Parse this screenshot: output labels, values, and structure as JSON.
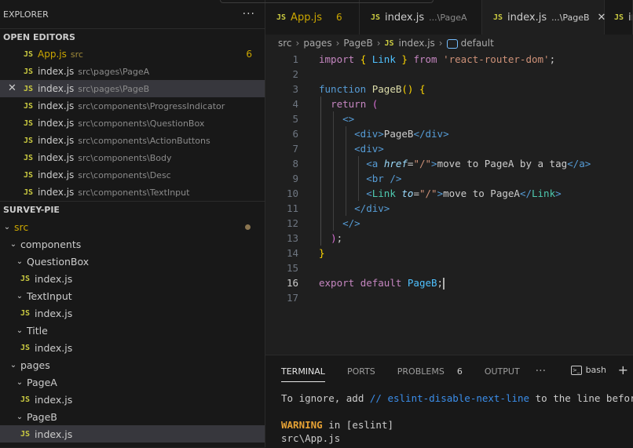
{
  "sidebar": {
    "title": "EXPLORER",
    "more": "···",
    "open_editors": {
      "title": "OPEN EDITORS",
      "items": [
        {
          "icon": "JS",
          "name": "App.js",
          "path": "src",
          "badge": "6"
        },
        {
          "icon": "JS",
          "name": "index.js",
          "path": "src\\pages\\PageA"
        },
        {
          "icon": "JS",
          "name": "index.js",
          "path": "src\\pages\\PageB"
        },
        {
          "icon": "JS",
          "name": "index.js",
          "path": "src\\components\\ProgressIndicator"
        },
        {
          "icon": "JS",
          "name": "index.js",
          "path": "src\\components\\QuestionBox"
        },
        {
          "icon": "JS",
          "name": "index.js",
          "path": "src\\components\\ActionButtons"
        },
        {
          "icon": "JS",
          "name": "index.js",
          "path": "src\\components\\Body"
        },
        {
          "icon": "JS",
          "name": "index.js",
          "path": "src\\components\\Desc"
        },
        {
          "icon": "JS",
          "name": "index.js",
          "path": "src\\components\\TextInput"
        }
      ]
    },
    "project": {
      "title": "SURVEY-PIE",
      "tree": [
        {
          "label": "src",
          "chevron": "⌄"
        },
        {
          "label": "components",
          "chevron": "⌄"
        },
        {
          "label": "QuestionBox",
          "chevron": "⌄"
        },
        {
          "label": "index.js",
          "icon": "JS"
        },
        {
          "label": "TextInput",
          "chevron": "⌄"
        },
        {
          "label": "index.js",
          "icon": "JS"
        },
        {
          "label": "Title",
          "chevron": "⌄"
        },
        {
          "label": "index.js",
          "icon": "JS"
        },
        {
          "label": "pages",
          "chevron": "⌄"
        },
        {
          "label": "PageA",
          "chevron": "⌄"
        },
        {
          "label": "index.js",
          "icon": "JS"
        },
        {
          "label": "PageB",
          "chevron": "⌄"
        },
        {
          "label": "index.js",
          "icon": "JS"
        }
      ]
    }
  },
  "tabs": [
    {
      "icon": "JS",
      "name": "App.js",
      "path": "",
      "badge": "6"
    },
    {
      "icon": "JS",
      "name": "index.js",
      "path": "...\\PageA"
    },
    {
      "icon": "JS",
      "name": "index.js",
      "path": "...\\PageB",
      "close": "✕"
    },
    {
      "icon": "JS",
      "name": "index"
    }
  ],
  "breadcrumb": {
    "parts": [
      "src",
      "pages",
      "PageB"
    ],
    "file_icon": "JS",
    "file": "index.js",
    "symbol": "default",
    "sep": "›"
  },
  "editor": {
    "line_numbers": [
      "1",
      "2",
      "3",
      "4",
      "5",
      "6",
      "7",
      "8",
      "9",
      "10",
      "11",
      "12",
      "13",
      "14",
      "15",
      "16",
      "17"
    ],
    "current_line": "16"
  },
  "panel": {
    "tabs": [
      "TERMINAL",
      "PORTS",
      "PROBLEMS",
      "OUTPUT"
    ],
    "problems_badge": "6",
    "more": "···",
    "shell": "bash",
    "add": "+",
    "terminal": {
      "line1_pre": "To ignore, add ",
      "line1_comment": "// eslint-disable-next-line",
      "line1_post": " to the line before.",
      "warning": "WARNING",
      "warning_rest": " in [eslint]",
      "last": "src\\App.js"
    }
  },
  "colors": {
    "background": "#1f1f1f",
    "sidebar": "#181818",
    "js_icon": "#cbcb41",
    "warning": "#cca700"
  }
}
